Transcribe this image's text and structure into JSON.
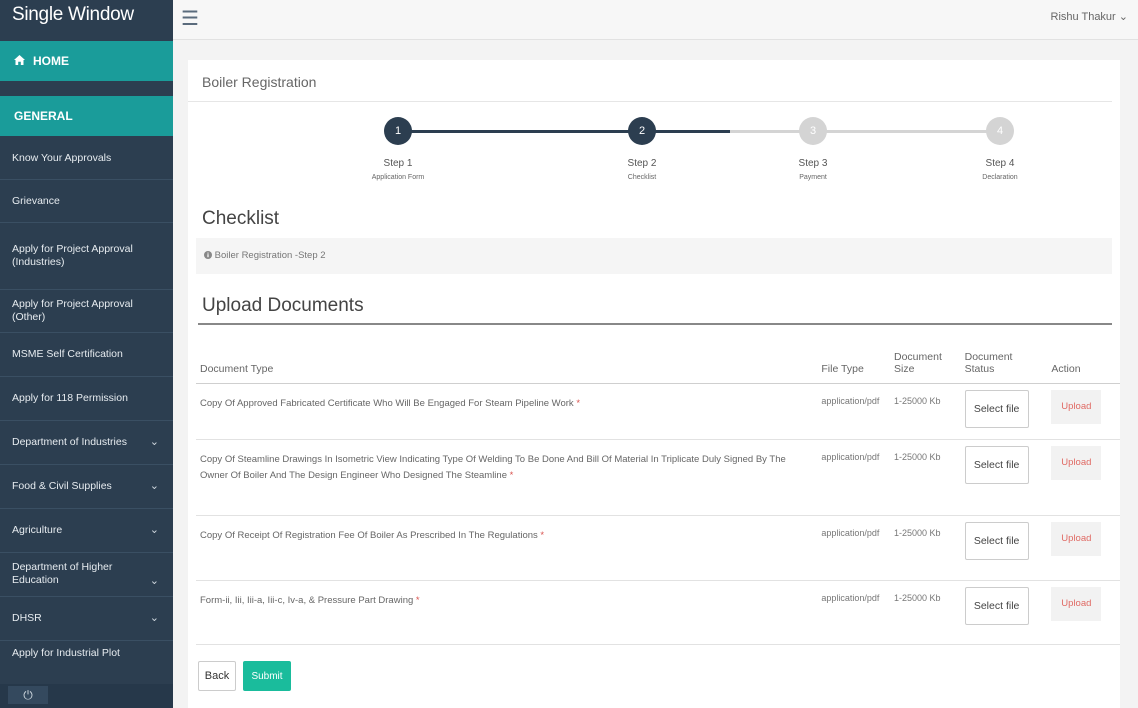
{
  "app": {
    "title": "Single Window"
  },
  "user": {
    "name": "Rishu Thakur"
  },
  "sidebar": {
    "home": "HOME",
    "general": "GENERAL",
    "items": [
      {
        "label": "Know Your Approvals",
        "chevron": ""
      },
      {
        "label": "Grievance",
        "chevron": ""
      },
      {
        "label": "Apply for Project Approval (Industries)",
        "chevron": ""
      },
      {
        "label": "Apply for Project Approval (Other)",
        "chevron": ""
      },
      {
        "label": "MSME Self Certification",
        "chevron": ""
      },
      {
        "label": "Apply for 118 Permission",
        "chevron": ""
      },
      {
        "label": "Department of Industries",
        "chevron": "⌄"
      },
      {
        "label": "Food & Civil Supplies",
        "chevron": "⌄"
      },
      {
        "label": "Agriculture",
        "chevron": "⌄"
      },
      {
        "label": "Department of Higher Education",
        "chevron": "⌄"
      },
      {
        "label": "DHSR",
        "chevron": "⌄"
      },
      {
        "label": "Apply for Industrial Plot",
        "chevron": ""
      }
    ]
  },
  "panel": {
    "title": "Boiler Registration",
    "steps": [
      {
        "number": "1",
        "label": "Step 1",
        "sub": "Application Form",
        "state": "active"
      },
      {
        "number": "2",
        "label": "Step 2",
        "sub": "Checklist",
        "state": "active"
      },
      {
        "number": "3",
        "label": "Step 3",
        "sub": "Payment",
        "state": "todo"
      },
      {
        "number": "4",
        "label": "Step 4",
        "sub": "Declaration",
        "state": "todo"
      }
    ],
    "checklist_title": "Checklist",
    "breadcrumb": "Boiler Registration -Step 2",
    "upload_title": "Upload Documents"
  },
  "table": {
    "headers": {
      "doc_type": "Document Type",
      "file_type": "File Type",
      "size": "Document Size",
      "status": "Document Status",
      "action": "Action"
    },
    "rows": [
      {
        "name": "Copy Of Approved Fabricated Certificate Who Will Be Engaged For Steam Pipeline Work",
        "file_type": "application/pdf",
        "size": "1-25000 Kb",
        "select_label": "Select file",
        "upload_label": "Upload"
      },
      {
        "name": "Copy Of Steamline Drawings In Isometric View Indicating Type Of Welding To Be Done And Bill Of Material In Triplicate Duly Signed By The Owner Of Boiler And The Design Engineer Who Designed The Steamline",
        "file_type": "application/pdf",
        "size": "1-25000 Kb",
        "select_label": "Select file",
        "upload_label": "Upload"
      },
      {
        "name": "Copy Of Receipt Of Registration Fee Of Boiler As Prescribed In The Regulations",
        "file_type": "application/pdf",
        "size": "1-25000 Kb",
        "select_label": "Select file",
        "upload_label": "Upload"
      },
      {
        "name": "Form-ii, Iii, Iii-a, Iii-c, Iv-a, & Pressure Part Drawing",
        "file_type": "application/pdf",
        "size": "1-25000 Kb",
        "select_label": "Select file",
        "upload_label": "Upload"
      }
    ],
    "required_mark": "*"
  },
  "buttons": {
    "back": "Back",
    "submit": "Submit"
  },
  "icons": {
    "home": "home-icon",
    "menu": "hamburger-menu-icon",
    "power": "power-icon",
    "info": "info-circle-icon"
  },
  "colors": {
    "sidebar": "#2c3e50",
    "accent": "#1a9c9a",
    "submit": "#1abc9c",
    "upload": "#e06a64",
    "required": "#d9534f"
  }
}
